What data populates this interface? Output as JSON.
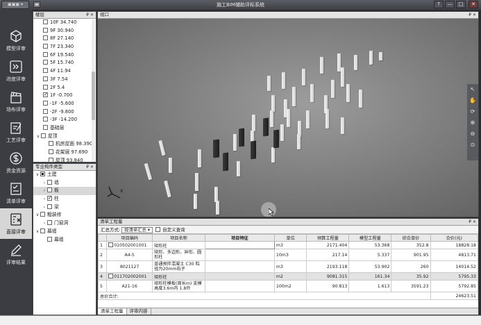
{
  "app": {
    "title": "施工BIM辅助评标系统"
  },
  "titlebar": {
    "help": "?",
    "minimize": "—",
    "restore": "□",
    "close": "✕"
  },
  "nav": [
    {
      "label": "模型评审",
      "icon": "cube-icon"
    },
    {
      "label": "进度评审",
      "icon": "progress-chevron-icon"
    },
    {
      "label": "场布评审",
      "icon": "clapperboard-icon"
    },
    {
      "label": "工艺评审",
      "icon": "edit-document-icon"
    },
    {
      "label": "资金资源",
      "icon": "dollar-coin-icon"
    },
    {
      "label": "清单评审",
      "icon": "checklist-icon"
    },
    {
      "label": "直接评审",
      "icon": "calculator-icon"
    },
    {
      "label": "评审结果",
      "icon": "pen-icon"
    }
  ],
  "floors": {
    "title": "楼层",
    "pin": "₽ ✕",
    "items": [
      {
        "label": "10F 34.740",
        "checked": false
      },
      {
        "label": "9F 30.940",
        "checked": false
      },
      {
        "label": "8F 27.140",
        "checked": false
      },
      {
        "label": "7F 23.340",
        "checked": false
      },
      {
        "label": "6F 19.540",
        "checked": false
      },
      {
        "label": "5F 15.740",
        "checked": false
      },
      {
        "label": "4F  11.94",
        "checked": false
      },
      {
        "label": "3F  7.54",
        "checked": false
      },
      {
        "label": "2F  5.4",
        "checked": false
      },
      {
        "label": "1F -0.700",
        "checked": true
      },
      {
        "label": "-1F  -5.600",
        "checked": false
      },
      {
        "label": "-2F -9.800",
        "checked": false
      },
      {
        "label": "-3F  -14.200",
        "checked": false
      },
      {
        "label": "基础层",
        "checked": false
      }
    ],
    "group": {
      "label": "屋顶"
    },
    "subitems": [
      {
        "label": "机房屋面 98.390"
      },
      {
        "label": "花架层 97.690"
      },
      {
        "label": "屋顶 93.840"
      }
    ]
  },
  "components": {
    "title": "专业构件类型",
    "pin": "₽ ✕",
    "root": "土建",
    "items": [
      {
        "label": "墙",
        "checked": false
      },
      {
        "label": "板",
        "checked": false
      },
      {
        "label": "柱",
        "checked": true
      },
      {
        "label": "梁",
        "checked": false
      }
    ],
    "group2": "粗装修",
    "group2_items": [
      {
        "label": "门窗洞"
      }
    ],
    "group3": "幕墙",
    "group3_items": [
      {
        "label": "幕墙"
      }
    ]
  },
  "viewport": {
    "title": "视口",
    "pin": "₽ ✕"
  },
  "view_tools": [
    "cursor-icon",
    "hand-icon",
    "orbit-icon",
    "zoom-in-icon",
    "zoom-out-icon",
    "zoom-fit-icon"
  ],
  "bill": {
    "title": "清单工程量",
    "pin": "₽ ✕",
    "summary_label": "汇总方式:",
    "summary_value": "按清单汇总",
    "custom_label": "自定义查询",
    "columns": [
      "",
      "项目编码",
      "项目名称",
      "项目特征",
      "单位",
      "预算工程量",
      "模型工程量",
      "综合单价",
      "合价(元)"
    ],
    "rows": [
      {
        "idx": "1",
        "code": "010502001001",
        "name": "矩形柱",
        "feature": "",
        "unit": "m3",
        "budget": "2171.404",
        "model": "53.368",
        "price": "352.8",
        "total": "18828.18",
        "hl": false,
        "tall": false
      },
      {
        "idx": "2",
        "code": "A4-5",
        "name": "矩形、多边形、异形、圆形柱",
        "feature": "",
        "unit": "10m3",
        "budget": "217.14",
        "model": "5.337",
        "price": "901.95",
        "total": "4813.71",
        "hl": false,
        "tall": true
      },
      {
        "idx": "3",
        "code": "8021127",
        "name": "普通预拌混凝土 C30 粒径为20mm石子",
        "feature": "",
        "unit": "m3",
        "budget": "2193.118",
        "model": "53.902",
        "price": "260",
        "total": "14014.52",
        "hl": false,
        "tall": true
      },
      {
        "idx": "4",
        "code": "011702002001",
        "name": "矩形柱",
        "feature": "",
        "unit": "m2",
        "budget": "9081.315",
        "model": "161.34",
        "price": "35.92",
        "total": "5795.33",
        "hl": true,
        "tall": false
      },
      {
        "idx": "5",
        "code": "A21-16",
        "name": "矩形柱模板(周长m) 支模高度3.6m内 1.8外",
        "feature": "",
        "unit": "100m2",
        "budget": "90.813",
        "model": "1.613",
        "price": "3591.23",
        "total": "5792.85",
        "hl": false,
        "tall": true
      }
    ],
    "total_label": "总价合计:",
    "total_value": "24623.51",
    "tabs": [
      "清单工程量",
      "评审内容"
    ]
  }
}
